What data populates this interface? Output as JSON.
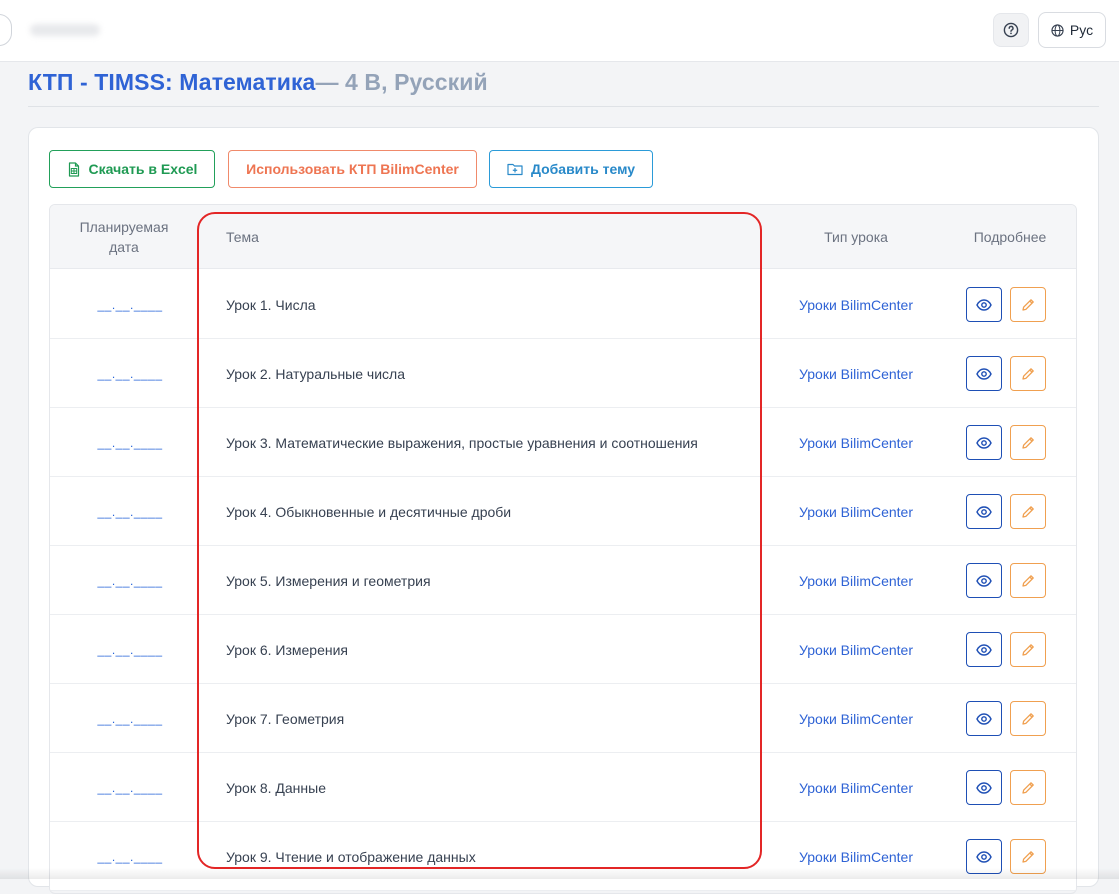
{
  "header": {
    "lang_label": "Рус"
  },
  "page": {
    "title_main": "КТП - TIMSS: Математика",
    "title_sub": "— 4 В, Русский"
  },
  "toolbar": {
    "excel_label": "Скачать в Excel",
    "bilim_label": "Использовать КТП BilimCenter",
    "add_label": "Добавить тему"
  },
  "table": {
    "headers": {
      "date": "Планируемая дата",
      "topic": "Тема",
      "type": "Тип урока",
      "more": "Подробнее"
    },
    "rows": [
      {
        "date": "__.__.____",
        "topic": "Урок 1. Числа",
        "type": "Уроки BilimCenter"
      },
      {
        "date": "__.__.____",
        "topic": "Урок 2. Натуральные числа",
        "type": "Уроки BilimCenter"
      },
      {
        "date": "__.__.____",
        "topic": "Урок 3. Математические выражения, простые уравнения и соотношения",
        "type": "Уроки BilimCenter"
      },
      {
        "date": "__.__.____",
        "topic": "Урок 4. Обыкновенные и десятичные дроби",
        "type": "Уроки BilimCenter"
      },
      {
        "date": "__.__.____",
        "topic": "Урок 5. Измерения и геометрия",
        "type": "Уроки BilimCenter"
      },
      {
        "date": "__.__.____",
        "topic": "Урок 6. Измерения",
        "type": "Уроки BilimCenter"
      },
      {
        "date": "__.__.____",
        "topic": "Урок 7. Геометрия",
        "type": "Уроки BilimCenter"
      },
      {
        "date": "__.__.____",
        "topic": "Урок 8. Данные",
        "type": "Уроки BilimCenter"
      },
      {
        "date": "__.__.____",
        "topic": "Урок 9. Чтение и отображение данных",
        "type": "Уроки BilimCenter"
      }
    ]
  },
  "colors": {
    "title_blue": "#2f63d5",
    "title_grey": "#94a3b8",
    "excel_green": "#1f9a53",
    "bilim_orange": "#ee7552",
    "add_blue": "#2889c9",
    "view_border": "#1e4fb5",
    "edit_border": "#f0a050",
    "highlight_red": "#e32626"
  },
  "icons": {
    "help": "question-circle-icon",
    "lang": "globe-icon",
    "excel": "spreadsheet-file-icon",
    "add": "folder-plus-icon",
    "view": "eye-icon",
    "edit": "pencil-icon"
  }
}
